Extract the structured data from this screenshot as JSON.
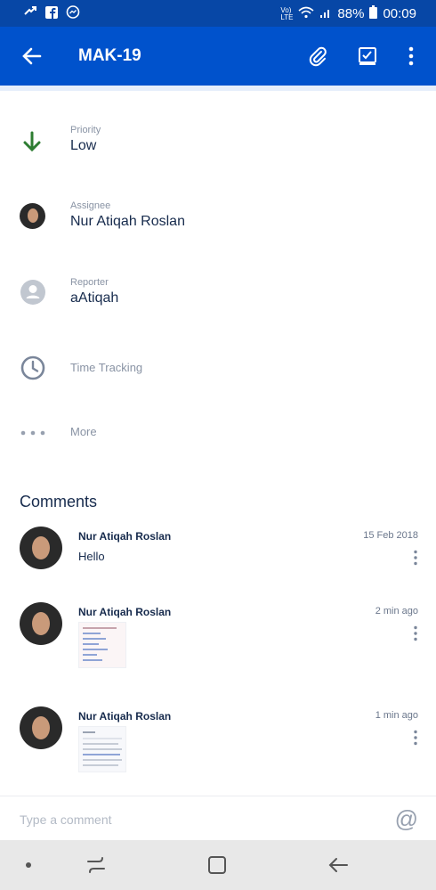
{
  "status_bar": {
    "battery": "88%",
    "time": "00:09",
    "icons": [
      "missed-call-icon",
      "facebook-icon",
      "messenger-icon",
      "volte-icon",
      "wifi-icon",
      "signal-icon",
      "battery-icon"
    ]
  },
  "app_bar": {
    "title": "MAK-19",
    "icons": [
      "back-arrow-icon",
      "attachment-icon",
      "checklist-icon",
      "more-vert-icon"
    ]
  },
  "fields": {
    "priority": {
      "label": "Priority",
      "value": "Low"
    },
    "assignee": {
      "label": "Assignee",
      "value": "Nur Atiqah Roslan"
    },
    "reporter": {
      "label": "Reporter",
      "value": "aAtiqah"
    },
    "time_tracking": {
      "label": "Time Tracking"
    },
    "more": {
      "label": "More"
    }
  },
  "comments": {
    "heading": "Comments",
    "items": [
      {
        "author": "Nur Atiqah Roslan",
        "time": "15 Feb 2018",
        "body": "Hello"
      },
      {
        "author": "Nur Atiqah Roslan",
        "time": "2 min ago",
        "body": ""
      },
      {
        "author": "Nur Atiqah Roslan",
        "time": "1 min ago",
        "body": ""
      }
    ]
  },
  "composer": {
    "placeholder": "Type a comment",
    "mention_symbol": "@"
  },
  "colors": {
    "status_bar": "#0747a6",
    "app_bar": "#0052cc",
    "priority_low": "#2e7d32",
    "text_primary": "#172b4d",
    "text_secondary": "#8993a4"
  }
}
